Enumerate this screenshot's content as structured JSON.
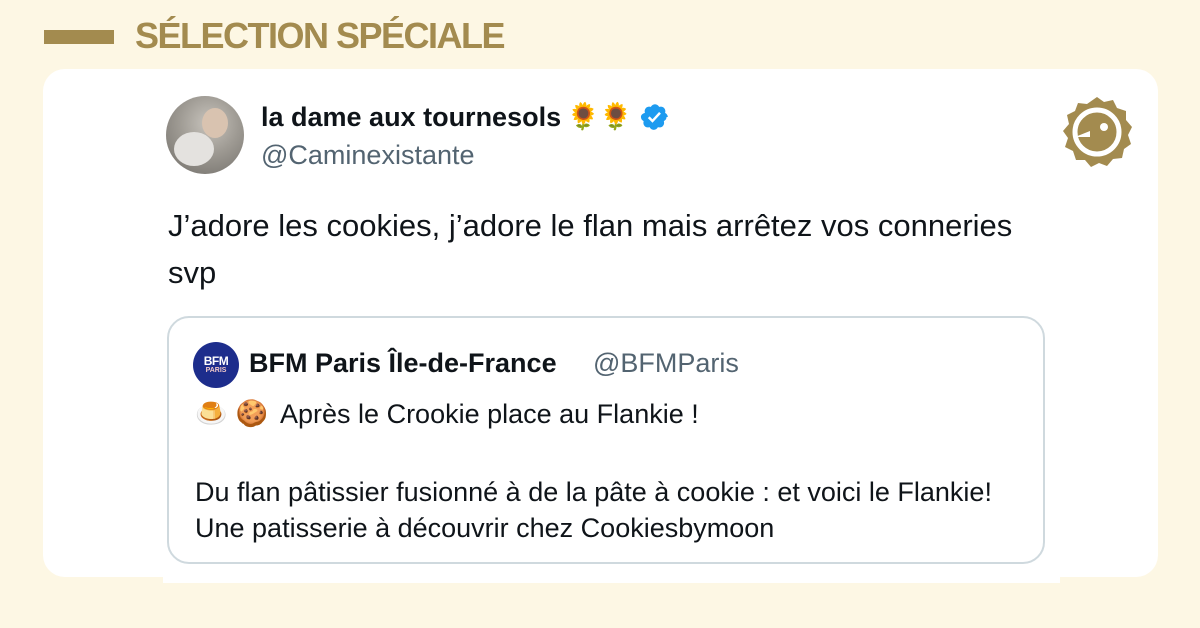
{
  "header": {
    "title": "SÉLECTION SPÉCIALE",
    "accent_color": "#a38b4f"
  },
  "tweet": {
    "author": {
      "display_name": "la dame aux tournesols",
      "name_emojis": "🌻🌻",
      "handle": "@Caminexistante",
      "verified": true,
      "verified_icon": "verified-badge-icon"
    },
    "text": "J’adore les cookies, j’adore le flan mais arrêtez vos conneries svp",
    "brand_icon": "brand-logo-icon"
  },
  "quoted_tweet": {
    "author": {
      "avatar_label": "BFM",
      "avatar_sub": "PARIS",
      "display_name": "BFM Paris Île-de-France",
      "handle": "@BFMParis"
    },
    "line1_emojis": "🍮 🍪",
    "line1": "Après le Crookie place au Flankie !",
    "body": "Du flan pâtissier fusionné à de la pâte à cookie : et voici le Flankie! Une patisserie à découvrir chez Cookiesbymoon"
  }
}
